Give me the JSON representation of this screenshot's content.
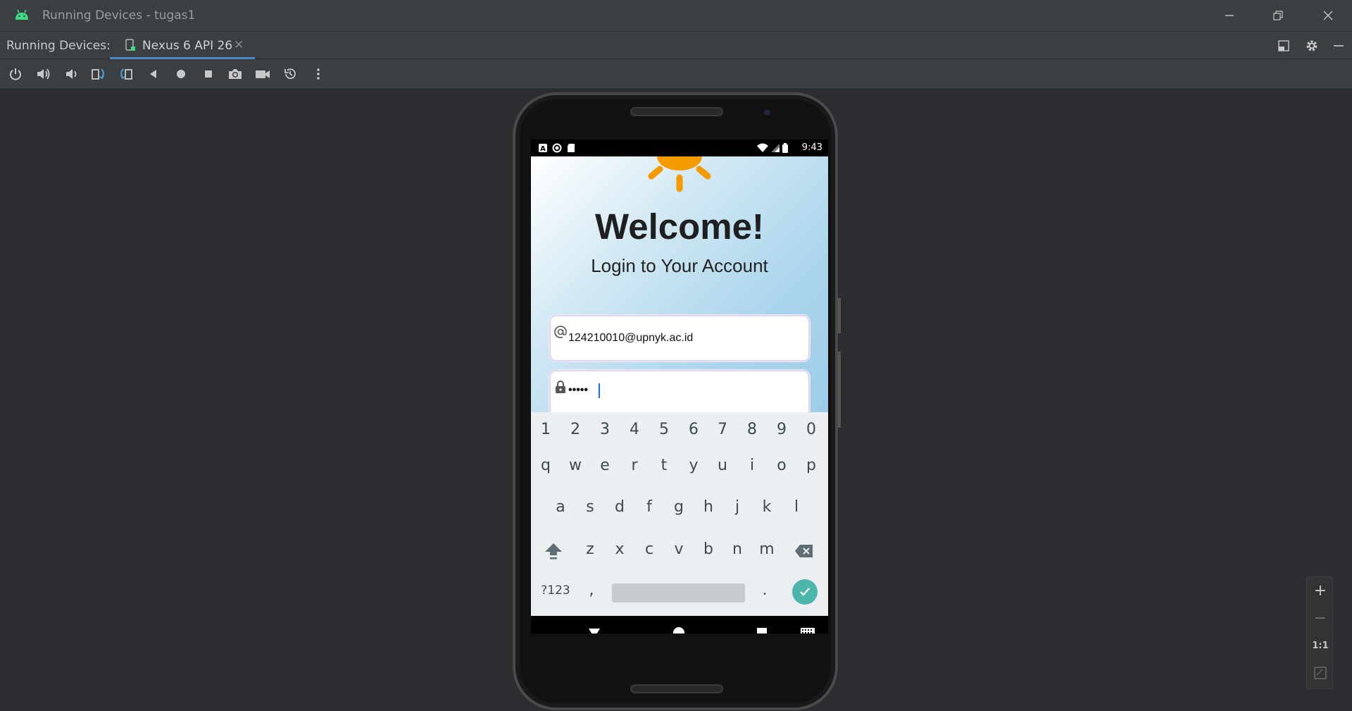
{
  "window": {
    "title": "Running Devices - tugas1",
    "minimize_icon": "minimize-icon",
    "restore_icon": "restore-icon",
    "close_icon": "close-icon"
  },
  "tabbar": {
    "label": "Running Devices:",
    "active_tab": "Nexus 6 API 26",
    "close_glyph": "✕"
  },
  "toolbar": {
    "items": [
      "power-icon",
      "volume-up-icon",
      "volume-down-icon",
      "rotate-left-icon",
      "rotate-right-icon",
      "back-icon",
      "home-icon",
      "overview-icon",
      "screenshot-icon",
      "screen-record-icon",
      "snapshot-icon",
      "more-icon"
    ]
  },
  "device": {
    "status_time": "9:43",
    "app": {
      "welcome": "Welcome!",
      "subtitle": "Login to Your Account",
      "email_value": "124210010@upnyk.ac.id",
      "password_value": "•••••"
    },
    "keyboard": {
      "row_numbers": [
        "1",
        "2",
        "3",
        "4",
        "5",
        "6",
        "7",
        "8",
        "9",
        "0"
      ],
      "row1": [
        "q",
        "w",
        "e",
        "r",
        "t",
        "y",
        "u",
        "i",
        "o",
        "p"
      ],
      "row2": [
        "a",
        "s",
        "d",
        "f",
        "g",
        "h",
        "j",
        "k",
        "l"
      ],
      "row3": [
        "z",
        "x",
        "c",
        "v",
        "b",
        "n",
        "m"
      ],
      "sym_label": "?123",
      "comma": ",",
      "period": "."
    }
  },
  "zoom": {
    "plus": "+",
    "minus": "−",
    "one_to_one": "1:1"
  },
  "colors": {
    "accent": "#4a88c7",
    "sun": "#f59b00",
    "enter_key": "#4db6ac"
  }
}
